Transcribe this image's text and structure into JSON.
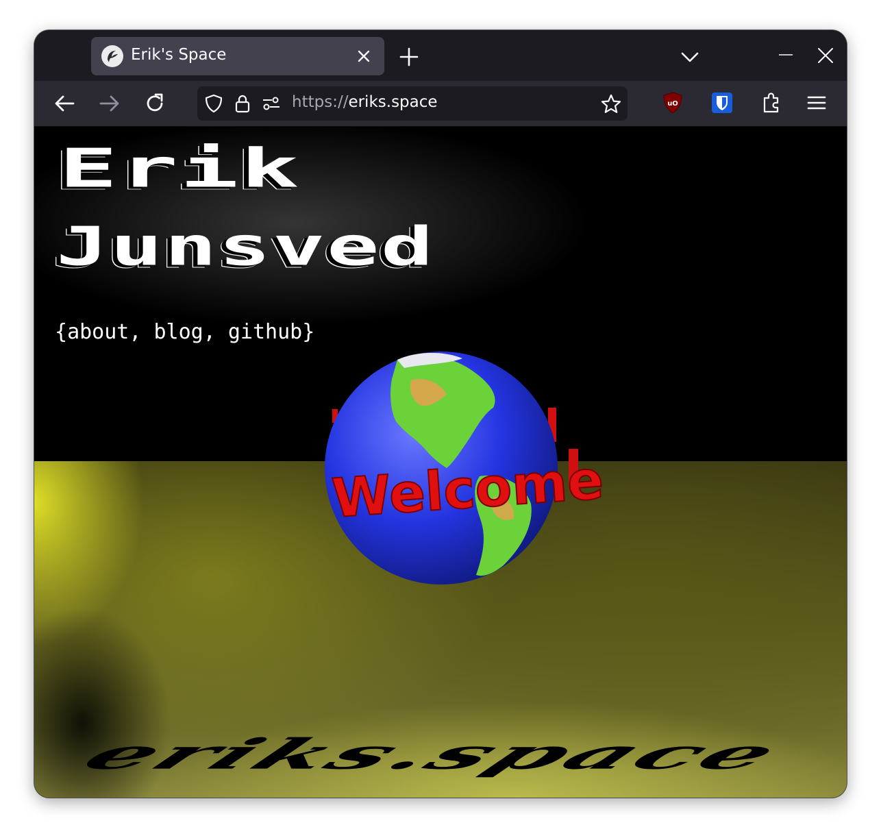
{
  "browser": {
    "tab": {
      "title": "Erik's Space",
      "favicon": "site-logo-icon"
    },
    "new_tab_icon": "plus-icon",
    "tab_list_icon": "chevron-down-icon",
    "minimize_icon": "minimize-icon",
    "close_icon": "close-icon",
    "nav": {
      "back_icon": "arrow-left-icon",
      "forward_icon": "arrow-right-icon",
      "reload_icon": "reload-icon"
    },
    "urlbar": {
      "scheme": "https://",
      "host": "eriks.space",
      "tracking_icon": "shield-icon",
      "lock_icon": "lock-icon",
      "permissions_icon": "permissions-icon",
      "bookmark_icon": "star-icon"
    },
    "extensions": {
      "ublock_label": "uO",
      "ublock_icon": "ublock-origin-icon",
      "bitwarden_icon": "bitwarden-shield-icon",
      "extensions_icon": "puzzle-icon",
      "menu_icon": "hamburger-menu-icon"
    }
  },
  "page": {
    "title_line_1": "Erik",
    "title_line_2": "Junsved",
    "links": {
      "open_brace": "{",
      "about": "about",
      "sep1": ", ",
      "blog": "blog",
      "sep2": ", ",
      "github": "github",
      "close_brace": "}"
    },
    "globe_text": "Welcome",
    "footer_logo": "eriks.space"
  },
  "colors": {
    "tab_strip_bg": "#1c1b22",
    "toolbar_bg": "#2b2a33",
    "tab_active_bg": "#42414d",
    "urlbar_bg": "#1c1b22",
    "page_bg": "#000000",
    "floor_yellow": "#c8c850",
    "globe_ocean": "#2030d8",
    "welcome_red": "#e01010",
    "ublock_red": "#800000",
    "bitwarden_blue": "#175ddc"
  }
}
